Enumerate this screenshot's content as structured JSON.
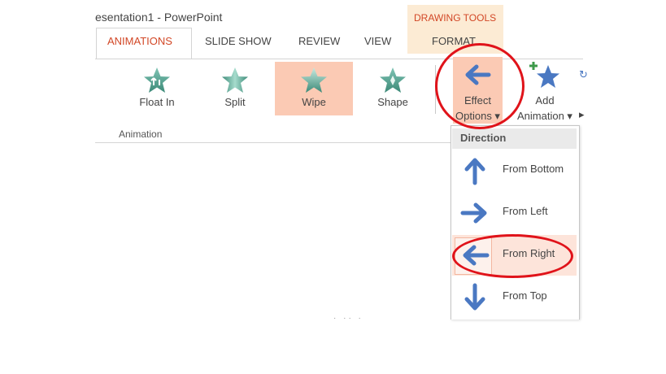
{
  "window": {
    "title": "esentation1 - PowerPoint"
  },
  "contextual_tab": {
    "label": "DRAWING TOOLS"
  },
  "tabs": [
    {
      "label": "ANIMATIONS",
      "active": true
    },
    {
      "label": "SLIDE SHOW"
    },
    {
      "label": "REVIEW"
    },
    {
      "label": "VIEW"
    },
    {
      "label": "FORMAT"
    }
  ],
  "gallery": {
    "items": [
      {
        "label": "Float In",
        "icon": "float-in-star-icon"
      },
      {
        "label": "Split",
        "icon": "split-star-icon"
      },
      {
        "label": "Wipe",
        "icon": "wipe-star-icon",
        "selected": true
      },
      {
        "label": "Shape",
        "icon": "shape-star-icon"
      }
    ]
  },
  "effect_options": {
    "line1": "Effect",
    "line2": "Options ▾"
  },
  "add_animation": {
    "line1": "Add",
    "line2": "Animation ▾"
  },
  "group": {
    "label": "Animation"
  },
  "dropdown": {
    "header": "Direction",
    "items": [
      {
        "label": "From Bottom",
        "icon": "arrow-up-icon"
      },
      {
        "label": "From Left",
        "icon": "arrow-right-icon"
      },
      {
        "label": "From Right",
        "icon": "arrow-left-icon",
        "selected": true
      },
      {
        "label": "From Top",
        "icon": "arrow-down-icon"
      }
    ]
  },
  "colors": {
    "accent": "#d24726",
    "selected_fill": "#fbcab4",
    "highlight_ring": "#e0131a",
    "arrow_blue": "#4a78c2",
    "star_green": "#4f9b8a"
  }
}
